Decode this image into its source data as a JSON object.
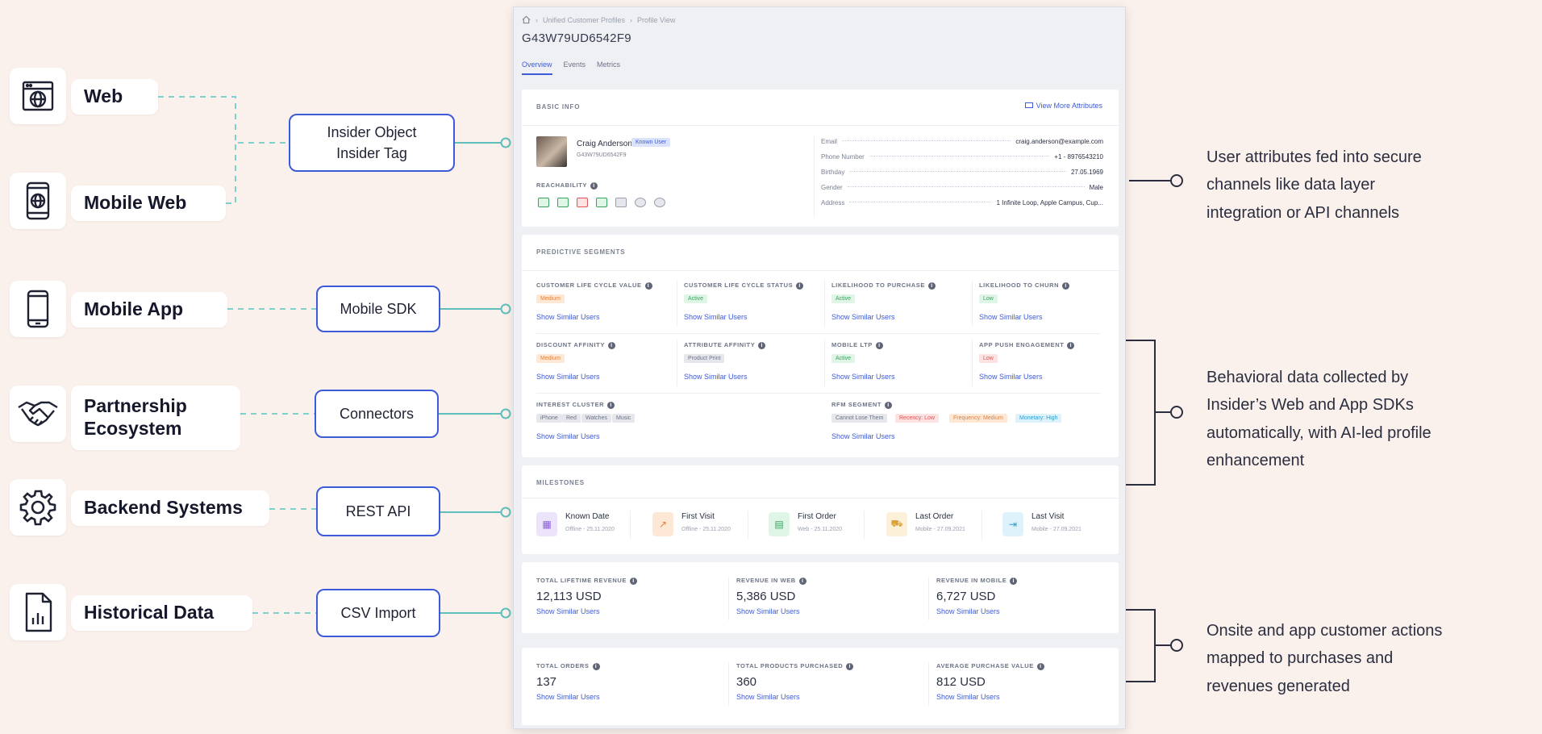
{
  "sources": [
    {
      "label": "Web",
      "icon": "browser-globe-icon"
    },
    {
      "label": "Mobile Web",
      "icon": "mobile-globe-icon"
    },
    {
      "label": "Mobile App",
      "icon": "smartphone-icon"
    },
    {
      "label": "Partnership Ecosystem",
      "icon": "handshake-icon"
    },
    {
      "label": "Backend Systems",
      "icon": "gear-icon"
    },
    {
      "label": "Historical Data",
      "icon": "document-chart-icon"
    }
  ],
  "integrations": {
    "insider_line1": "Insider Object",
    "insider_line2": "Insider Tag",
    "mobile_sdk": "Mobile SDK",
    "connectors": "Connectors",
    "rest_api": "REST API",
    "csv_import": "CSV Import"
  },
  "profile": {
    "breadcrumb_1": "Unified Customer Profiles",
    "breadcrumb_2": "Profile View",
    "id": "G43W79UD6542F9",
    "tabs": [
      "Overview",
      "Events",
      "Metrics"
    ],
    "basic_info_title": "BASIC INFO",
    "view_more": "View More Attributes",
    "name": "Craig Anderson",
    "known_badge": "Known User",
    "sub_id": "G43W79UD6542F9",
    "reachability": "REACHABILITY",
    "attributes": [
      {
        "label": "Email",
        "value": "craig.anderson@example.com"
      },
      {
        "label": "Phone Number",
        "value": "+1 - 8976543210"
      },
      {
        "label": "Birthday",
        "value": "27.05.1969"
      },
      {
        "label": "Gender",
        "value": "Male"
      },
      {
        "label": "Address",
        "value": "1 Infinite Loop, Apple Campus, Cup..."
      }
    ],
    "predictive_title": "PREDICTIVE SEGMENTS",
    "show_similar": "Show Similar Users",
    "segments": [
      {
        "label": "CUSTOMER LIFE CYCLE VALUE",
        "pill": "Medium",
        "color": "orange"
      },
      {
        "label": "CUSTOMER LIFE CYCLE STATUS",
        "pill": "Active",
        "color": "green"
      },
      {
        "label": "LIKELIHOOD TO PURCHASE",
        "pill": "Active",
        "color": "green"
      },
      {
        "label": "LIKELIHOOD TO CHURN",
        "pill": "Low",
        "color": "green"
      },
      {
        "label": "DISCOUNT AFFINITY",
        "pill": "Medium",
        "color": "orange"
      },
      {
        "label": "ATTRIBUTE AFFINITY",
        "pill": "Product Print",
        "color": "gray"
      },
      {
        "label": "MOBILE LTP",
        "pill": "Active",
        "color": "green"
      },
      {
        "label": "APP PUSH ENGAGEMENT",
        "pill": "Low",
        "color": "red"
      }
    ],
    "interest_label": "INTEREST CLUSTER",
    "interest_pills": [
      "iPhone",
      "Red",
      "Watches",
      "Music"
    ],
    "rfm_label": "RFM SEGMENT",
    "rfm_pills": [
      {
        "text": "Cannot Lose Them",
        "color": "gray"
      },
      {
        "text": "Recency: Low",
        "color": "red"
      },
      {
        "text": "Frequency: Medium",
        "color": "orange"
      },
      {
        "text": "Monetary: High",
        "color": "blue"
      }
    ],
    "milestones_title": "MILESTONES",
    "milestones": [
      {
        "title": "Known Date",
        "sub": "Offline - 25.11.2020"
      },
      {
        "title": "First Visit",
        "sub": "Offline - 25.11.2020"
      },
      {
        "title": "First Order",
        "sub": "Web - 25.11.2020"
      },
      {
        "title": "Last Order",
        "sub": "Mobile - 27.09.2021"
      },
      {
        "title": "Last Visit",
        "sub": "Mobile - 27.09.2021"
      }
    ],
    "revenue": [
      {
        "label": "TOTAL LIFETIME REVENUE",
        "value": "12,113 USD"
      },
      {
        "label": "REVENUE IN WEB",
        "value": "5,386 USD"
      },
      {
        "label": "REVENUE IN MOBILE",
        "value": "6,727 USD"
      }
    ],
    "orders": [
      {
        "label": "TOTAL ORDERS",
        "value": "137"
      },
      {
        "label": "TOTAL PRODUCTS PURCHASED",
        "value": "360"
      },
      {
        "label": "AVERAGE PURCHASE VALUE",
        "value": "812 USD"
      }
    ]
  },
  "notes": {
    "n1_l1": "User attributes fed into secure",
    "n1_l2": "channels like data layer",
    "n1_l3": "integration or API channels",
    "n2_l1": "Behavioral data collected by",
    "n2_l2": "Insider’s Web and App SDKs",
    "n2_l3": "automatically, with AI-led profile",
    "n2_l4": "enhancement",
    "n3_l1": "Onsite and app customer actions",
    "n3_l2": "mapped to purchases and",
    "n3_l3": "revenues generated"
  },
  "colors": {
    "accent": "#3d5bd9",
    "connector": "#5fbfbd",
    "bracket": "#2a2e3f",
    "background": "#fbf1ec"
  }
}
